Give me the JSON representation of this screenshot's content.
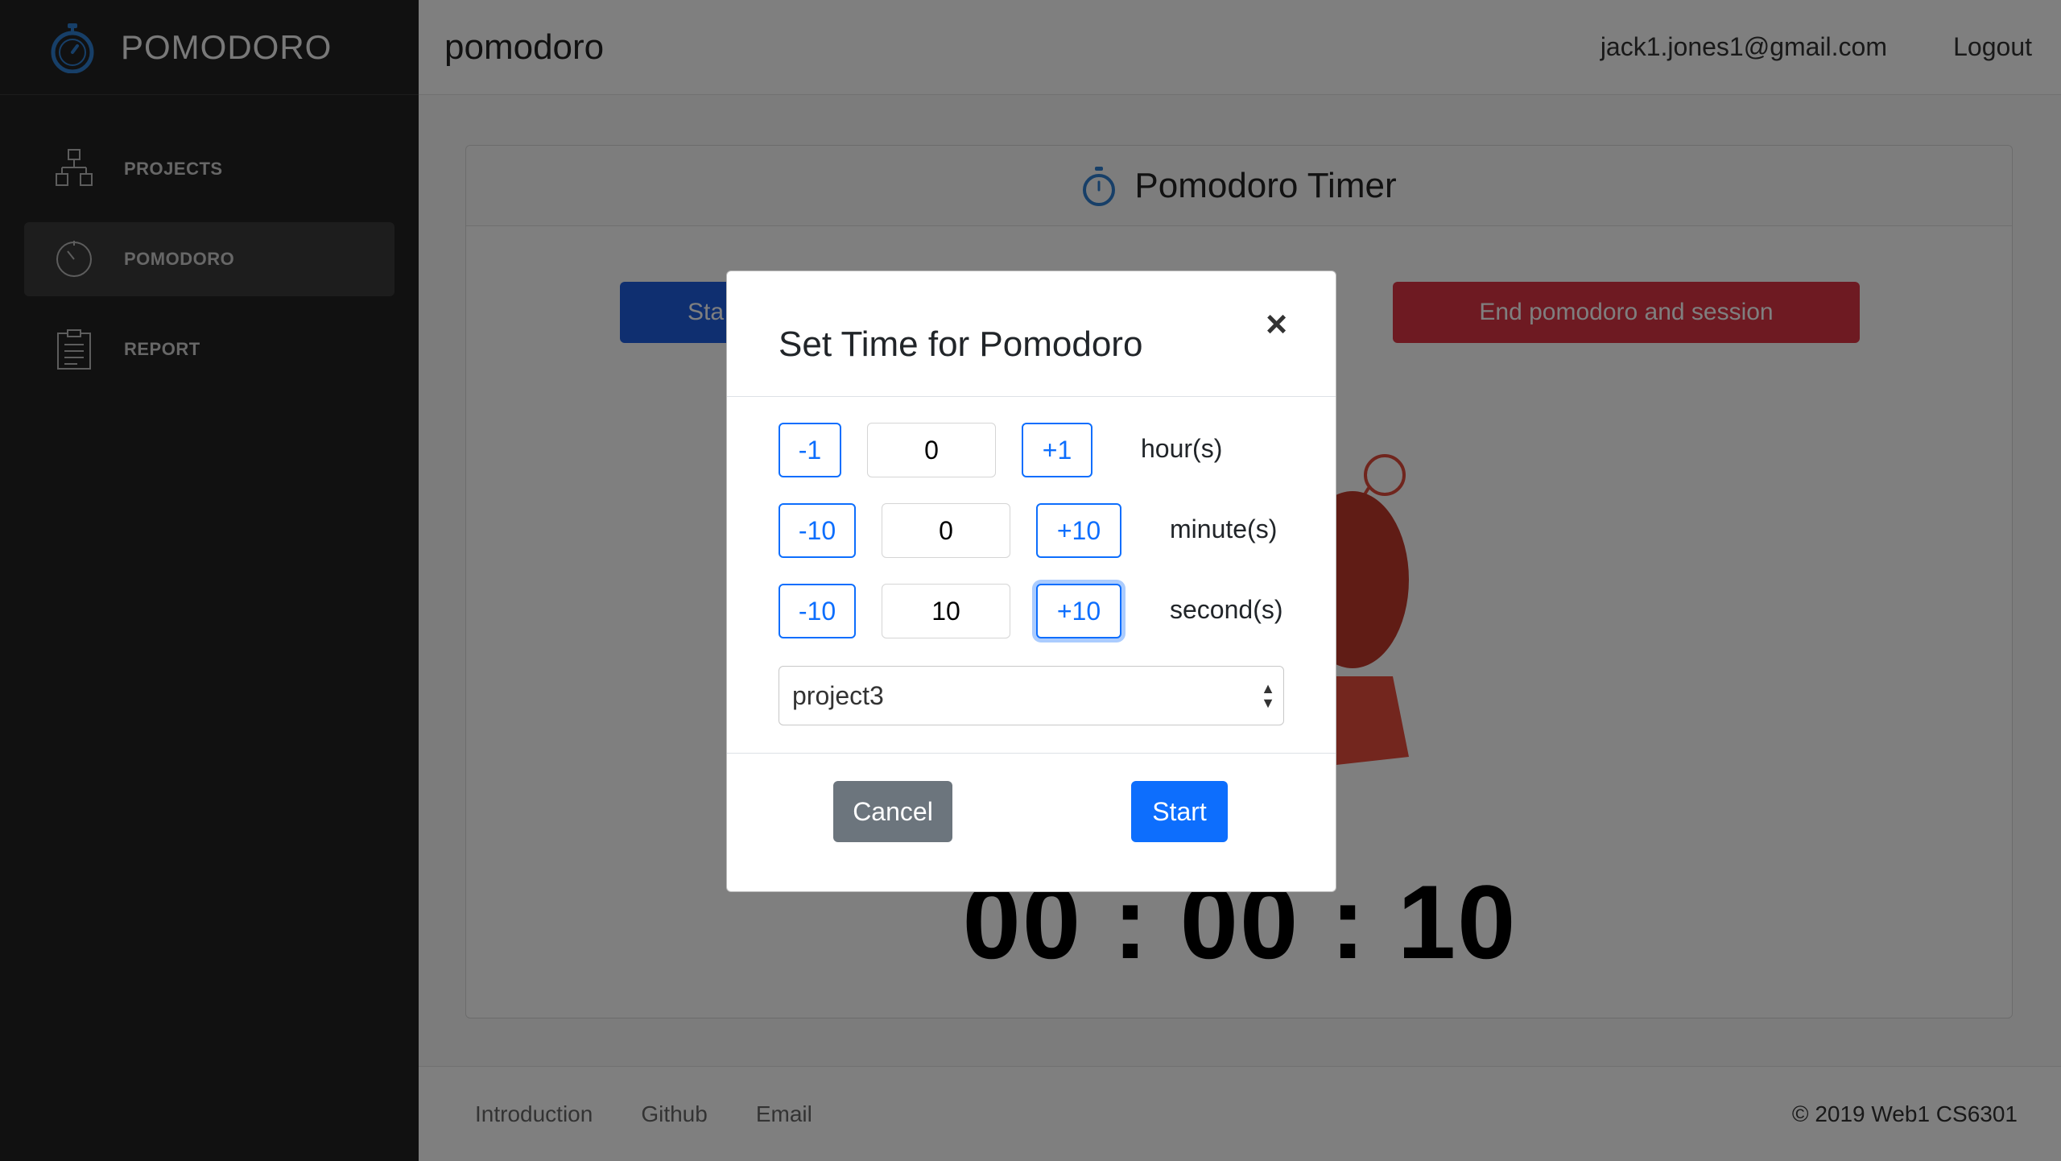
{
  "sidebar": {
    "brand": "POMODORO",
    "items": [
      {
        "label": "PROJECTS",
        "icon": "projects-icon"
      },
      {
        "label": "POMODORO",
        "icon": "pomodoro-icon"
      },
      {
        "label": "REPORT",
        "icon": "report-icon"
      }
    ],
    "active": "POMODORO"
  },
  "header": {
    "title": "pomodoro",
    "user_email": "jack1.jones1@gmail.com",
    "logout": "Logout"
  },
  "card": {
    "title": "Pomodoro Timer",
    "start_button_partial": "Sta",
    "end_button": "End pomodoro and session",
    "timer": "00 : 00 : 10"
  },
  "footer": {
    "links": [
      "Introduction",
      "Github",
      "Email"
    ],
    "copyright": "© 2019 Web1 CS6301"
  },
  "modal": {
    "title": "Set Time for Pomodoro",
    "close": "×",
    "hours": {
      "dec": "-1",
      "value": "0",
      "inc": "+1",
      "unit": "hour(s)"
    },
    "minutes": {
      "dec": "-10",
      "value": "0",
      "inc": "+10",
      "unit": "minute(s)"
    },
    "seconds": {
      "dec": "-10",
      "value": "10",
      "inc": "+10",
      "unit": "second(s)"
    },
    "project": "project3",
    "cancel": "Cancel",
    "start": "Start"
  },
  "colors": {
    "sidebar_bg": "#222222",
    "accent_blue": "#0d6efd",
    "danger_red": "#dc3545",
    "secondary_gray": "#6c757d",
    "icon_blue": "#2f7fd0"
  }
}
